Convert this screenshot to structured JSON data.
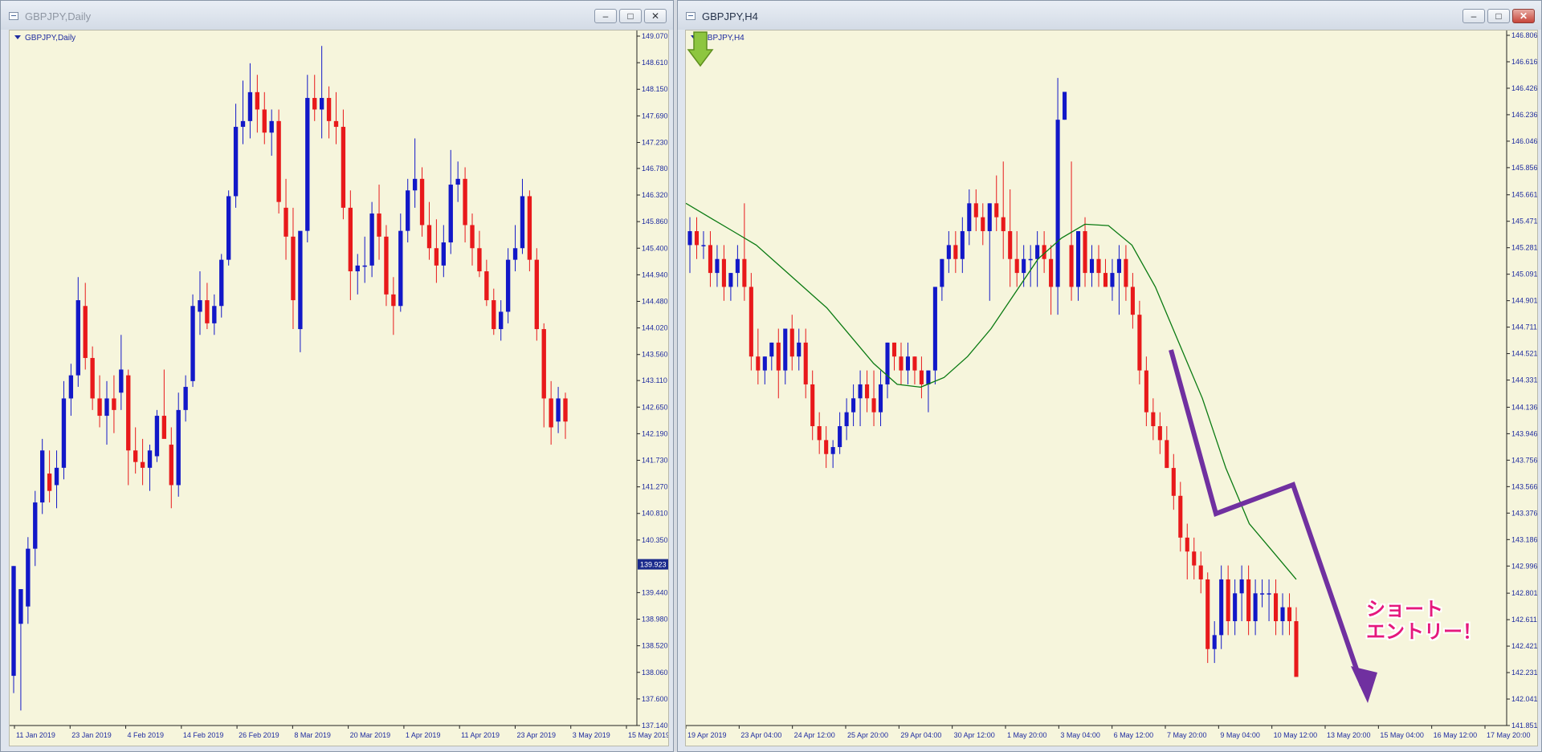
{
  "windows": {
    "daily": {
      "title": "GBPJPY,Daily",
      "label": "GBPJPY,Daily"
    },
    "h4": {
      "title": "GBPJPY,H4",
      "label": "GBPJPY,H4"
    }
  },
  "window_buttons": {
    "minimize": "‒",
    "maximize": "□",
    "close": "✕"
  },
  "annotation": {
    "text": "ショート\nエントリー！",
    "color": "#e5187c",
    "arrow_color": "#7030a0",
    "signal_color": "#8dc63f"
  },
  "colors": {
    "background": "#f6f5dc",
    "bull": "#1218c8",
    "bear": "#e8191b",
    "ma": "#0a7a12",
    "axis": "#1f2ca0"
  },
  "chart_data": [
    {
      "type": "candlestick",
      "symbol": "GBPJPY",
      "timeframe": "Daily",
      "y_ticks": [
        "149.070",
        "148.610",
        "148.150",
        "147.690",
        "147.230",
        "146.780",
        "146.320",
        "145.860",
        "145.400",
        "144.940",
        "144.480",
        "144.020",
        "143.560",
        "143.110",
        "142.650",
        "142.190",
        "141.730",
        "141.270",
        "140.810",
        "140.350",
        "139.440",
        "138.980",
        "138.520",
        "138.060",
        "137.600",
        "137.140"
      ],
      "ylim": [
        137.14,
        149.07
      ],
      "current_price": "139.923",
      "x_ticks": [
        "11 Jan 2019",
        "23 Jan 2019",
        "4 Feb 2019",
        "14 Feb 2019",
        "26 Feb 2019",
        "8 Mar 2019",
        "20 Mar 2019",
        "1 Apr 2019",
        "11 Apr 2019",
        "23 Apr 2019",
        "3 May 2019",
        "15 May 2019"
      ],
      "ohlc": [
        [
          138.0,
          139.9,
          137.7,
          139.9
        ],
        [
          138.9,
          139.1,
          137.4,
          139.5
        ],
        [
          139.2,
          140.4,
          138.9,
          140.2
        ],
        [
          140.2,
          141.2,
          139.9,
          141.0
        ],
        [
          141.0,
          142.1,
          140.8,
          141.9
        ],
        [
          141.5,
          141.9,
          141.0,
          141.2
        ],
        [
          141.3,
          141.9,
          140.9,
          141.6
        ],
        [
          141.6,
          143.1,
          141.4,
          142.8
        ],
        [
          142.8,
          143.4,
          142.5,
          143.2
        ],
        [
          143.2,
          144.9,
          143.0,
          144.5
        ],
        [
          144.4,
          144.8,
          143.3,
          143.5
        ],
        [
          143.5,
          143.7,
          142.6,
          142.8
        ],
        [
          142.8,
          143.2,
          142.3,
          142.5
        ],
        [
          142.5,
          143.1,
          142.0,
          142.8
        ],
        [
          142.8,
          143.2,
          142.2,
          142.6
        ],
        [
          142.9,
          143.9,
          142.6,
          143.3
        ],
        [
          143.2,
          143.3,
          141.3,
          141.9
        ],
        [
          141.9,
          142.3,
          141.5,
          141.7
        ],
        [
          141.7,
          142.1,
          141.3,
          141.6
        ],
        [
          141.6,
          142.0,
          141.2,
          141.9
        ],
        [
          141.8,
          142.6,
          141.7,
          142.5
        ],
        [
          142.5,
          143.3,
          142.3,
          142.1
        ],
        [
          142.0,
          142.3,
          140.9,
          141.3
        ],
        [
          141.3,
          142.9,
          141.1,
          142.6
        ],
        [
          142.6,
          143.2,
          142.4,
          143.0
        ],
        [
          143.1,
          144.6,
          143.0,
          144.4
        ],
        [
          144.3,
          145.0,
          143.9,
          144.5
        ],
        [
          144.5,
          144.8,
          144.0,
          144.1
        ],
        [
          144.1,
          144.6,
          143.9,
          144.4
        ],
        [
          144.4,
          145.3,
          144.2,
          145.2
        ],
        [
          145.2,
          146.4,
          145.1,
          146.3
        ],
        [
          146.3,
          147.9,
          146.1,
          147.5
        ],
        [
          147.5,
          148.3,
          147.2,
          147.6
        ],
        [
          147.6,
          148.6,
          147.3,
          148.1
        ],
        [
          148.1,
          148.4,
          147.4,
          147.8
        ],
        [
          147.8,
          148.1,
          147.2,
          147.4
        ],
        [
          147.4,
          147.8,
          147.0,
          147.6
        ],
        [
          147.6,
          147.8,
          146.0,
          146.2
        ],
        [
          146.1,
          146.6,
          145.2,
          145.6
        ],
        [
          145.6,
          146.1,
          144.0,
          144.5
        ],
        [
          144.0,
          144.3,
          143.6,
          145.7
        ],
        [
          145.7,
          148.4,
          145.5,
          148.0
        ],
        [
          148.0,
          148.4,
          147.6,
          147.8
        ],
        [
          147.8,
          148.9,
          147.3,
          148.0
        ],
        [
          148.0,
          148.2,
          147.3,
          147.6
        ],
        [
          147.6,
          148.1,
          147.2,
          147.5
        ],
        [
          147.5,
          147.8,
          145.9,
          146.1
        ],
        [
          146.1,
          146.4,
          144.5,
          145.0
        ],
        [
          145.0,
          145.3,
          144.6,
          145.1
        ],
        [
          145.1,
          145.6,
          144.8,
          145.1
        ],
        [
          145.1,
          146.2,
          144.9,
          146.0
        ],
        [
          146.0,
          146.5,
          145.2,
          145.6
        ],
        [
          145.6,
          145.8,
          144.4,
          144.6
        ],
        [
          144.6,
          144.9,
          143.9,
          144.4
        ],
        [
          144.4,
          146.0,
          144.3,
          145.7
        ],
        [
          145.7,
          146.6,
          145.5,
          146.4
        ],
        [
          146.4,
          147.3,
          146.1,
          146.6
        ],
        [
          146.6,
          146.8,
          145.6,
          145.8
        ],
        [
          145.8,
          146.2,
          145.2,
          145.4
        ],
        [
          145.4,
          145.9,
          144.8,
          145.1
        ],
        [
          145.1,
          145.8,
          144.9,
          145.5
        ],
        [
          145.5,
          147.1,
          145.3,
          146.5
        ],
        [
          146.5,
          146.9,
          146.2,
          146.6
        ],
        [
          146.6,
          146.8,
          145.5,
          145.8
        ],
        [
          145.8,
          146.0,
          145.1,
          145.4
        ],
        [
          145.4,
          145.7,
          144.9,
          145.0
        ],
        [
          145.0,
          145.2,
          144.4,
          144.5
        ],
        [
          144.5,
          144.7,
          143.9,
          144.0
        ],
        [
          144.0,
          144.5,
          143.8,
          144.3
        ],
        [
          144.3,
          145.4,
          144.1,
          145.2
        ],
        [
          145.2,
          145.8,
          145.0,
          145.4
        ],
        [
          145.4,
          146.6,
          145.3,
          146.3
        ],
        [
          146.3,
          146.4,
          145.0,
          145.2
        ],
        [
          145.2,
          145.4,
          143.8,
          144.0
        ],
        [
          144.0,
          144.1,
          142.3,
          142.8
        ],
        [
          142.8,
          143.1,
          142.0,
          142.3
        ],
        [
          142.4,
          143.0,
          142.2,
          142.8
        ],
        [
          142.8,
          142.9,
          142.1,
          142.4
        ]
      ]
    },
    {
      "type": "candlestick",
      "symbol": "GBPJPY",
      "timeframe": "H4",
      "y_ticks": [
        "146.806",
        "146.616",
        "146.426",
        "146.236",
        "146.046",
        "145.856",
        "145.661",
        "145.471",
        "145.281",
        "145.091",
        "144.901",
        "144.711",
        "144.521",
        "144.331",
        "144.136",
        "143.946",
        "143.756",
        "143.566",
        "143.376",
        "143.186",
        "142.996",
        "142.801",
        "142.611",
        "142.421",
        "142.231",
        "142.041",
        "141.851"
      ],
      "ylim": [
        141.851,
        146.806
      ],
      "x_ticks": [
        "19 Apr 2019",
        "23 Apr 04:00",
        "24 Apr 12:00",
        "25 Apr 20:00",
        "29 Apr 04:00",
        "30 Apr 12:00",
        "1 May 20:00",
        "3 May 04:00",
        "6 May 12:00",
        "7 May 20:00",
        "9 May 04:00",
        "10 May 12:00",
        "13 May 20:00",
        "15 May 04:00",
        "16 May 12:00",
        "17 May 20:00"
      ],
      "series": [
        {
          "name": "",
          "values": [
            145.6,
            145.5,
            145.4,
            145.3,
            145.15,
            145.0,
            144.85,
            144.65,
            144.45,
            144.3,
            144.28,
            144.35,
            144.5,
            144.7,
            144.95,
            145.2,
            145.35,
            145.45,
            145.44,
            145.3,
            145.0,
            144.6,
            144.2,
            143.7,
            143.3,
            143.1,
            142.9
          ]
        }
      ],
      "ohlc": [
        [
          145.3,
          145.5,
          145.1,
          145.4
        ],
        [
          145.4,
          145.5,
          145.2,
          145.3
        ],
        [
          145.3,
          145.4,
          145.2,
          145.3
        ],
        [
          145.3,
          145.4,
          145.0,
          145.1
        ],
        [
          145.1,
          145.3,
          145.0,
          145.2
        ],
        [
          145.2,
          145.3,
          144.9,
          145.0
        ],
        [
          145.0,
          145.1,
          144.9,
          145.1
        ],
        [
          145.1,
          145.3,
          145.0,
          145.2
        ],
        [
          145.2,
          145.6,
          144.9,
          145.0
        ],
        [
          145.0,
          145.1,
          144.4,
          144.5
        ],
        [
          144.5,
          144.7,
          144.3,
          144.4
        ],
        [
          144.4,
          144.5,
          144.3,
          144.5
        ],
        [
          144.5,
          144.6,
          144.4,
          144.6
        ],
        [
          144.6,
          144.7,
          144.2,
          144.4
        ],
        [
          144.4,
          144.7,
          144.3,
          144.7
        ],
        [
          144.7,
          144.8,
          144.4,
          144.5
        ],
        [
          144.5,
          144.7,
          144.4,
          144.6
        ],
        [
          144.6,
          144.7,
          144.2,
          144.3
        ],
        [
          144.3,
          144.4,
          143.9,
          144.0
        ],
        [
          144.0,
          144.1,
          143.8,
          143.9
        ],
        [
          143.9,
          144.0,
          143.7,
          143.8
        ],
        [
          143.8,
          143.9,
          143.7,
          143.85
        ],
        [
          143.85,
          144.1,
          143.8,
          144.0
        ],
        [
          144.0,
          144.2,
          143.9,
          144.1
        ],
        [
          144.1,
          144.3,
          144.0,
          144.2
        ],
        [
          144.2,
          144.4,
          144.0,
          144.3
        ],
        [
          144.3,
          144.4,
          144.1,
          144.2
        ],
        [
          144.2,
          144.4,
          144.0,
          144.1
        ],
        [
          144.1,
          144.4,
          144.0,
          144.3
        ],
        [
          144.3,
          144.6,
          144.2,
          144.6
        ],
        [
          144.6,
          144.6,
          144.4,
          144.5
        ],
        [
          144.5,
          144.6,
          144.3,
          144.4
        ],
        [
          144.4,
          144.6,
          144.3,
          144.5
        ],
        [
          144.5,
          144.5,
          144.3,
          144.4
        ],
        [
          144.4,
          144.5,
          144.2,
          144.3
        ],
        [
          144.3,
          144.4,
          144.1,
          144.4
        ],
        [
          144.4,
          145.0,
          144.3,
          145.0
        ],
        [
          145.0,
          145.2,
          144.9,
          145.2
        ],
        [
          145.2,
          145.4,
          145.1,
          145.3
        ],
        [
          145.3,
          145.4,
          145.1,
          145.2
        ],
        [
          145.2,
          145.5,
          145.1,
          145.4
        ],
        [
          145.4,
          145.7,
          145.3,
          145.6
        ],
        [
          145.6,
          145.7,
          145.4,
          145.5
        ],
        [
          145.5,
          145.6,
          145.3,
          145.4
        ],
        [
          145.4,
          145.6,
          144.9,
          145.6
        ],
        [
          145.6,
          145.8,
          145.4,
          145.5
        ],
        [
          145.5,
          145.9,
          145.2,
          145.4
        ],
        [
          145.4,
          145.7,
          145.0,
          145.2
        ],
        [
          145.2,
          145.4,
          145.0,
          145.1
        ],
        [
          145.1,
          145.3,
          145.0,
          145.2
        ],
        [
          145.2,
          145.3,
          145.0,
          145.2
        ],
        [
          145.2,
          145.4,
          145.0,
          145.3
        ],
        [
          145.3,
          145.4,
          145.1,
          145.2
        ],
        [
          145.2,
          145.3,
          144.8,
          145.0
        ],
        [
          145.0,
          146.5,
          144.8,
          146.2
        ],
        [
          146.2,
          146.4,
          146.2,
          146.4
        ],
        [
          145.3,
          145.9,
          144.9,
          145.0
        ],
        [
          145.0,
          145.4,
          144.9,
          145.4
        ],
        [
          145.4,
          145.5,
          145.0,
          145.1
        ],
        [
          145.1,
          145.3,
          145.0,
          145.2
        ],
        [
          145.2,
          145.3,
          145.0,
          145.1
        ],
        [
          145.1,
          145.2,
          145.0,
          145.0
        ],
        [
          145.0,
          145.2,
          144.9,
          145.1
        ],
        [
          145.1,
          145.3,
          144.8,
          145.2
        ],
        [
          145.2,
          145.3,
          144.9,
          145.0
        ],
        [
          145.0,
          145.1,
          144.7,
          144.8
        ],
        [
          144.8,
          144.9,
          144.3,
          144.4
        ],
        [
          144.4,
          144.5,
          144.0,
          144.1
        ],
        [
          144.1,
          144.2,
          143.9,
          144.0
        ],
        [
          144.0,
          144.1,
          143.8,
          143.9
        ],
        [
          143.9,
          144.0,
          143.7,
          143.7
        ],
        [
          143.7,
          143.8,
          143.4,
          143.5
        ],
        [
          143.5,
          143.6,
          143.1,
          143.2
        ],
        [
          143.2,
          143.3,
          142.9,
          143.1
        ],
        [
          143.1,
          143.2,
          142.9,
          143.0
        ],
        [
          143.0,
          143.1,
          142.8,
          142.9
        ],
        [
          142.9,
          142.95,
          142.3,
          142.4
        ],
        [
          142.4,
          142.6,
          142.3,
          142.5
        ],
        [
          142.5,
          143.0,
          142.4,
          142.9
        ],
        [
          142.9,
          143.0,
          142.5,
          142.6
        ],
        [
          142.6,
          142.9,
          142.5,
          142.8
        ],
        [
          142.8,
          143.0,
          142.6,
          142.9
        ],
        [
          142.9,
          143.0,
          142.5,
          142.6
        ],
        [
          142.6,
          142.9,
          142.5,
          142.8
        ],
        [
          142.8,
          142.9,
          142.7,
          142.8
        ],
        [
          142.8,
          142.9,
          142.6,
          142.8
        ],
        [
          142.8,
          142.9,
          142.5,
          142.6
        ],
        [
          142.6,
          142.8,
          142.5,
          142.7
        ],
        [
          142.7,
          142.8,
          142.5,
          142.6
        ],
        [
          142.6,
          142.7,
          142.3,
          142.2
        ]
      ]
    }
  ]
}
